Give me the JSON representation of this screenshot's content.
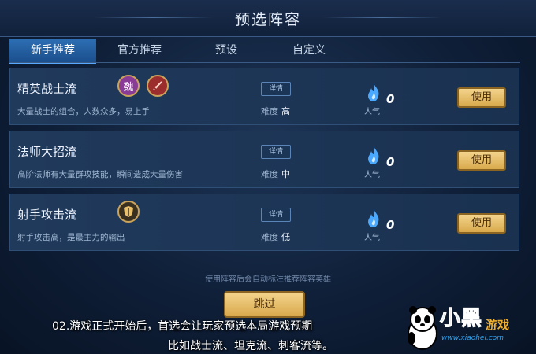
{
  "header": {
    "title": "预选阵容"
  },
  "tabs": [
    {
      "label": "新手推荐",
      "active": true
    },
    {
      "label": "官方推荐",
      "active": false
    },
    {
      "label": "预设",
      "active": false
    },
    {
      "label": "自定义",
      "active": false
    }
  ],
  "lineups": [
    {
      "name": "精英战士流",
      "description": "大量战士的组合，人数众多，易上手",
      "detail_label": "详情",
      "difficulty_label": "难度",
      "difficulty": "高",
      "popularity_label": "人气",
      "popularity": "0",
      "use_label": "使用",
      "badges": [
        "purple-race-icon",
        "sword-icon"
      ]
    },
    {
      "name": "法师大招流",
      "description": "高阶法师有大量群攻技能，瞬间造成大量伤害",
      "detail_label": "详情",
      "difficulty_label": "难度",
      "difficulty": "中",
      "popularity_label": "人气",
      "popularity": "0",
      "use_label": "使用",
      "badges": []
    },
    {
      "name": "射手攻击流",
      "description": "射手攻击高，是最主力的输出",
      "detail_label": "详情",
      "difficulty_label": "难度",
      "difficulty": "低",
      "popularity_label": "人气",
      "popularity": "0",
      "use_label": "使用",
      "badges": [
        "shield-icon"
      ]
    }
  ],
  "footer": {
    "hint": "使用阵容后会自动标注推荐阵容英雄",
    "skip_label": "跳过"
  },
  "captions": {
    "line1": "02.游戏正式开始后，首选会让玩家预选本局游戏预期",
    "line2": "比如战士流、坦克流、刺客流等。"
  },
  "watermark": {
    "brand_1": "小黑",
    "brand_2": "游戏",
    "url": "www.xiaohei.com"
  },
  "colors": {
    "accent_tab": "#2d6fb4",
    "gold_button": "#e2b45c",
    "panel": "#1d3556"
  }
}
